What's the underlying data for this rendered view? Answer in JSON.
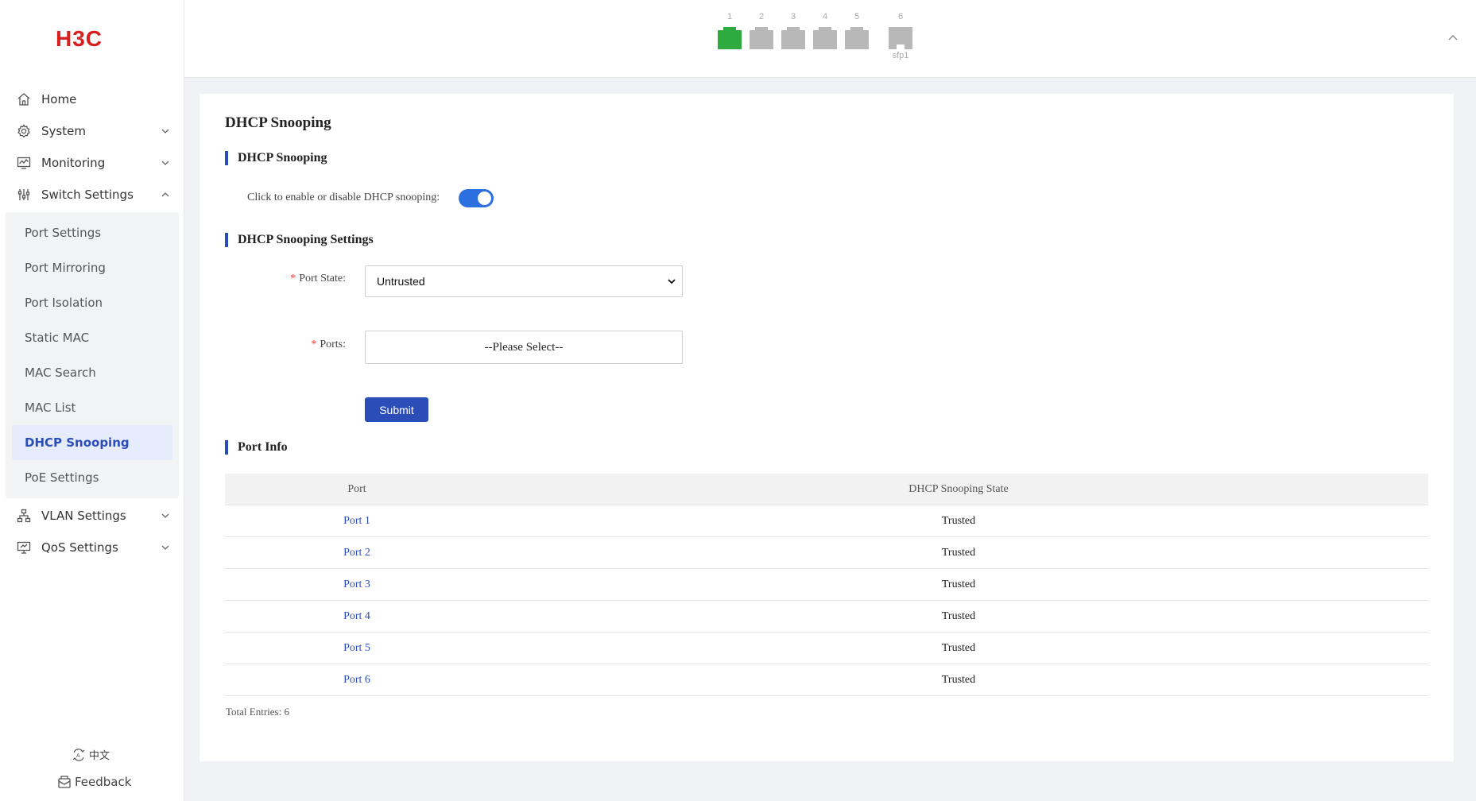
{
  "brand": {
    "logo_text": "H3C",
    "logo_color": "#d81e1e"
  },
  "sidebar": {
    "items": [
      {
        "label": "Home",
        "icon": "home-icon"
      },
      {
        "label": "System",
        "icon": "gear-icon",
        "expandable": true
      },
      {
        "label": "Monitoring",
        "icon": "monitor-chart-icon",
        "expandable": true
      },
      {
        "label": "Switch Settings",
        "icon": "sliders-icon",
        "expandable": true,
        "expanded": true
      },
      {
        "label": "VLAN Settings",
        "icon": "network-icon",
        "expandable": true
      },
      {
        "label": "QoS Settings",
        "icon": "qos-icon",
        "expandable": true
      }
    ],
    "switch_sub": [
      "Port Settings",
      "Port Mirroring",
      "Port Isolation",
      "Static MAC",
      "MAC Search",
      "MAC List",
      "DHCP Snooping",
      "PoE Settings"
    ],
    "active_sub": "DHCP Snooping",
    "language": "中文",
    "feedback": "Feedback"
  },
  "topbar": {
    "ports": [
      {
        "num": "1",
        "status": "up",
        "color": "#2eaa3f"
      },
      {
        "num": "2",
        "status": "down",
        "color": "#b8b8b8"
      },
      {
        "num": "3",
        "status": "down",
        "color": "#b8b8b8"
      },
      {
        "num": "4",
        "status": "down",
        "color": "#b8b8b8"
      },
      {
        "num": "5",
        "status": "down",
        "color": "#b8b8b8"
      },
      {
        "num": "6",
        "status": "down",
        "color": "#b8b8b8",
        "caption": "sfp1"
      }
    ]
  },
  "main": {
    "page_title": "DHCP Snooping",
    "section_snooping": "DHCP Snooping",
    "toggle_label": "Click to enable or disable DHCP snooping:",
    "toggle_on": true,
    "section_settings": "DHCP Snooping Settings",
    "port_state_label": "Port State:",
    "port_state_value": "Untrusted",
    "ports_label": "Ports:",
    "ports_placeholder": "--Please Select--",
    "required_mark": "*",
    "submit_label": "Submit",
    "section_port_info": "Port Info",
    "table": {
      "headers": [
        "Port",
        "DHCP Snooping State"
      ],
      "rows": [
        {
          "port": "Port 1",
          "state": "Trusted"
        },
        {
          "port": "Port 2",
          "state": "Trusted"
        },
        {
          "port": "Port 3",
          "state": "Trusted"
        },
        {
          "port": "Port 4",
          "state": "Trusted"
        },
        {
          "port": "Port 5",
          "state": "Trusted"
        },
        {
          "port": "Port 6",
          "state": "Trusted"
        }
      ]
    },
    "total_entries": "Total Entries: 6"
  },
  "colors": {
    "accent": "#2b4db8",
    "toggle": "#2b6fe0"
  }
}
